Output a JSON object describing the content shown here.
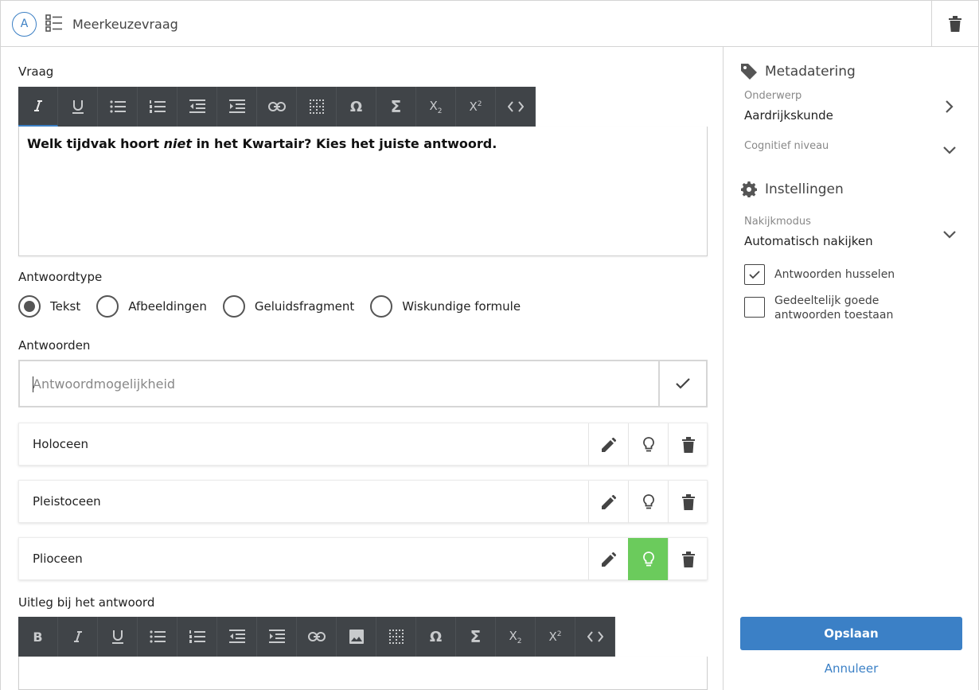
{
  "header": {
    "letter": "A",
    "title": "Meerkeuzevraag"
  },
  "question": {
    "label": "Vraag",
    "text_before": "Welk tijdvak hoort ",
    "text_emph": "niet",
    "text_after": " in het Kwartair? Kies het juiste antwoord."
  },
  "answer_type": {
    "label": "Antwoordtype",
    "options": [
      "Tekst",
      "Afbeeldingen",
      "Geluidsfragment",
      "Wiskundige formule"
    ],
    "selected": "Tekst"
  },
  "answers": {
    "label": "Antwoorden",
    "input_placeholder": "Antwoordmogelijkheid",
    "items": [
      {
        "text": "Holoceen",
        "hint_active": false
      },
      {
        "text": "Pleistoceen",
        "hint_active": false
      },
      {
        "text": "Plioceen",
        "hint_active": true
      }
    ]
  },
  "explanation": {
    "label": "Uitleg bij het antwoord"
  },
  "sidebar": {
    "metadata_title": "Metadatering",
    "subject_label": "Onderwerp",
    "subject_value": "Aardrijkskunde",
    "cognitive_label": "Cognitief niveau",
    "settings_title": "Instellingen",
    "grading_label": "Nakijkmodus",
    "grading_value": "Automatisch nakijken",
    "shuffle_label": "Antwoorden husselen",
    "shuffle_checked": true,
    "partial_label": "Gedeeltelijk goede antwoorden toestaan",
    "partial_checked": false,
    "save_label": "Opslaan",
    "cancel_label": "Annuleer"
  },
  "colors": {
    "accent": "#3b80c6",
    "toolbar_bg": "#404448",
    "hint_active": "#6bcb5c"
  }
}
